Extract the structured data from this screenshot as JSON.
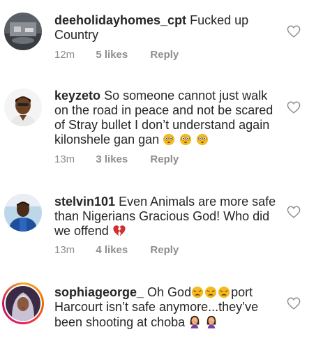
{
  "comments": [
    {
      "username": "deeholidayhomes_cpt",
      "text": "Fucked up Country",
      "time": "12m",
      "likes": "5 likes",
      "reply": "Reply",
      "emojis": []
    },
    {
      "username": "keyzeto",
      "text": "So someone cannot just walk on the road in peace and not be scared of Stray bullet I don’t understand again kilonshele gan gan",
      "time": "13m",
      "likes": "3 likes",
      "reply": "Reply",
      "emojis": [
        "flushed-face",
        "flushed-face",
        "flushed-face"
      ]
    },
    {
      "username": "stelvin101",
      "text": "Even Animals are more safe than Nigerians Gracious God! Who did we offend",
      "time": "13m",
      "likes": "4 likes",
      "reply": "Reply",
      "emojis": [
        "broken-heart"
      ]
    },
    {
      "username": "sophiageorge_",
      "text_before": "Oh God",
      "text_after": "port Harcourt isn’t safe anymore...they’ve been shooting at choba",
      "emojis_mid": [
        "weary-face",
        "weary-face",
        "weary-face"
      ],
      "emojis_end": [
        "woman-facepalming",
        "woman-facepalming"
      ]
    }
  ],
  "colors": {
    "text": "#262626",
    "meta": "#8e8e8e",
    "heart": "#8e8e8e",
    "emoji_yellow": "#f5b921",
    "broken_heart": "#d32f2f",
    "story_ring": "#e91e63"
  }
}
